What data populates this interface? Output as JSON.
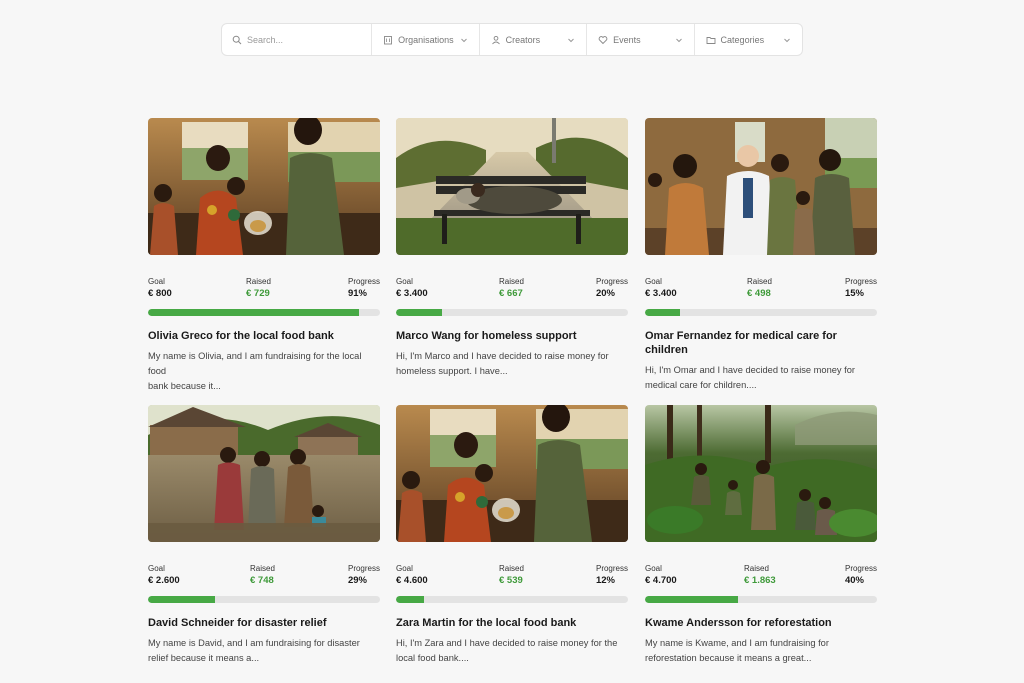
{
  "search": {
    "placeholder": "Search..."
  },
  "filters": [
    {
      "label": "Organisations",
      "icon": "building-icon"
    },
    {
      "label": "Creators",
      "icon": "person-icon"
    },
    {
      "label": "Events",
      "icon": "heart-icon"
    },
    {
      "label": "Categories",
      "icon": "folder-icon"
    }
  ],
  "labels": {
    "goal": "Goal",
    "raised": "Raised",
    "progress": "Progress"
  },
  "campaigns": [
    {
      "goal": "€ 800",
      "raised": "€ 729",
      "progress": "91%",
      "progress_value": 0.91,
      "title": "Olivia Greco for the local food bank",
      "desc_1": "My name is Olivia, and I am fundraising for the local food",
      "desc_2": "bank because it...",
      "image": "food-bank-photo"
    },
    {
      "goal": "€ 3.400",
      "raised": "€ 667",
      "progress": "20%",
      "progress_value": 0.2,
      "title": "Marco Wang for homeless support",
      "desc_1": "Hi, I'm Marco and I have decided to raise money for",
      "desc_2": "homeless support. I have...",
      "image": "park-bench-photo"
    },
    {
      "goal": "€ 3.400",
      "raised": "€ 498",
      "progress": "15%",
      "progress_value": 0.15,
      "title": "Omar Fernandez for medical care for children",
      "desc_1": "Hi, I'm Omar and I have decided to raise money for",
      "desc_2": "medical care for children....",
      "image": "doctor-photo"
    },
    {
      "goal": "€ 2.600",
      "raised": "€ 748",
      "progress": "29%",
      "progress_value": 0.29,
      "title": "David Schneider for disaster relief",
      "desc_1": "My name is David, and I am fundraising for disaster",
      "desc_2": "relief because it means a...",
      "image": "flood-photo"
    },
    {
      "goal": "€ 4.600",
      "raised": "€ 539",
      "progress": "12%",
      "progress_value": 0.12,
      "title": "Zara Martin for the local food bank",
      "desc_1": "Hi, I'm Zara and I have decided to raise money for the",
      "desc_2": "local food bank....",
      "image": "food-bank-photo"
    },
    {
      "goal": "€ 4.700",
      "raised": "€ 1.863",
      "progress": "40%",
      "progress_value": 0.4,
      "title": "Kwame Andersson for reforestation",
      "desc_1": "My name is Kwame, and I am fundraising for",
      "desc_2": "reforestation because it means a great...",
      "image": "forest-photo"
    }
  ]
}
